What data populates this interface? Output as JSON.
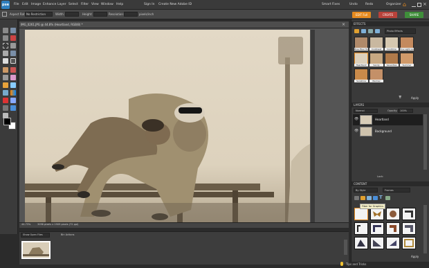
{
  "app": {
    "logo_text": "pse",
    "menu": [
      "File",
      "Edit",
      "Image",
      "Enhance",
      "Layer",
      "Select",
      "Filter",
      "View",
      "Window",
      "Help"
    ],
    "sign_in": "Sign In",
    "create_id": "Create New Adobe ID",
    "right_links": [
      "Smart Fixes",
      "Undo",
      "Redo",
      "Organizer"
    ],
    "modes": {
      "edit": "EDIT Full",
      "create": "CREATE",
      "share": "SHARE"
    }
  },
  "options_bar": {
    "aspect_label": "Aspect Ratio",
    "aspect_value": "No Restriction",
    "width_label": "Width:",
    "height_label": "Height:",
    "resolution_label": "Resolution:",
    "units": "pixels/inch"
  },
  "document": {
    "tab_title": "IMG_0261.JPG @ 44.8% (Heartland, RGB/8) *",
    "zoom": "44.73%",
    "status": "3096 pixels x 1909 pixels (72 ppi)"
  },
  "bin": {
    "show_label": "Show Open Files",
    "bin_actions": "Bin Actions"
  },
  "effects": {
    "title": "EFFECTS",
    "dropdown": "Photo Effects",
    "thumbs": [
      "Blue-Fiber Tones",
      "Cooltoast",
      "Cooltime",
      "Fine Light Gold",
      "Heartland",
      "Sandy",
      "Seventies",
      "Summer",
      "Sunshine",
      "Warmer"
    ],
    "apply": "Apply"
  },
  "layers": {
    "title": "LAYERS",
    "blend_mode": "Normal",
    "opacity_label": "Opacity:",
    "opacity_value": "100%",
    "lock_label": "Lock:",
    "items": [
      "Heartland",
      "Background"
    ]
  },
  "content": {
    "title": "CONTENT",
    "filter1": "By Style",
    "filter2": "Frames",
    "tooltip": "Fiber for Graphics",
    "apply": "Apply"
  },
  "bottom": {
    "tips": "Tips and Tricks"
  },
  "colors": {
    "accent_orange": "#e58a1f",
    "create_red": "#b8423a",
    "share_green": "#3f8e3a",
    "select_blue": "#2f7fbf"
  }
}
